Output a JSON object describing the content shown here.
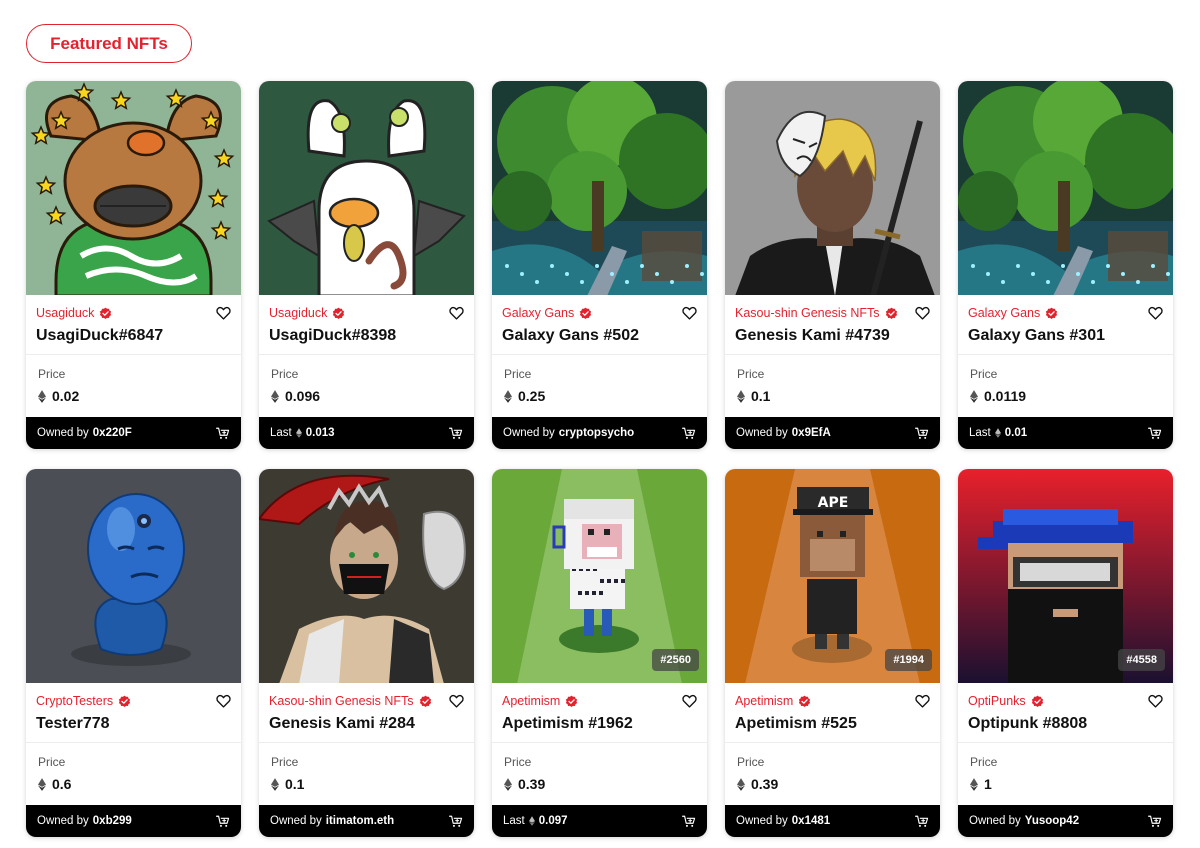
{
  "header": {
    "title": "Featured NFTs",
    "accent": "#e2232f"
  },
  "labels": {
    "price": "Price",
    "owned_by": "Owned by",
    "last": "Last"
  },
  "cards": [
    {
      "collection": "Usagiduck",
      "name": "UsagiDuck#6847",
      "price": "0.02",
      "footer_type": "owned",
      "footer_value": "0x220F",
      "art": "duck-brown"
    },
    {
      "collection": "Usagiduck",
      "name": "UsagiDuck#8398",
      "price": "0.096",
      "footer_type": "last",
      "footer_value": "0.013",
      "art": "duck-white"
    },
    {
      "collection": "Galaxy Gans",
      "name": "Galaxy Gans #502",
      "price": "0.25",
      "footer_type": "owned",
      "footer_value": "cryptopsycho",
      "art": "forest"
    },
    {
      "collection": "Kasou-shin Genesis NFTs",
      "name": "Genesis Kami #4739",
      "price": "0.1",
      "footer_type": "owned",
      "footer_value": "0x9EfA",
      "art": "masked-samurai"
    },
    {
      "collection": "Galaxy Gans",
      "name": "Galaxy Gans #301",
      "price": "0.0119",
      "footer_type": "last",
      "footer_value": "0.01",
      "art": "forest"
    },
    {
      "collection": "CryptoTesters",
      "name": "Tester778",
      "price": "0.6",
      "footer_type": "owned",
      "footer_value": "0xb299",
      "art": "blue-blob"
    },
    {
      "collection": "Kasou-shin Genesis NFTs",
      "name": "Genesis Kami #284",
      "price": "0.1",
      "footer_type": "owned",
      "footer_value": "itimatom.eth",
      "art": "scythe-warrior"
    },
    {
      "collection": "Apetimism",
      "name": "Apetimism #1962",
      "price": "0.39",
      "footer_type": "last",
      "footer_value": "0.097",
      "art": "voxel-white-ape",
      "badge": "#2560"
    },
    {
      "collection": "Apetimism",
      "name": "Apetimism #525",
      "price": "0.39",
      "footer_type": "owned",
      "footer_value": "0x1481",
      "art": "voxel-brown-ape",
      "badge": "#1994"
    },
    {
      "collection": "OptiPunks",
      "name": "Optipunk #8808",
      "price": "1",
      "footer_type": "owned",
      "footer_value": "Yusoop42",
      "art": "pixel-punk",
      "badge": "#4558"
    }
  ]
}
